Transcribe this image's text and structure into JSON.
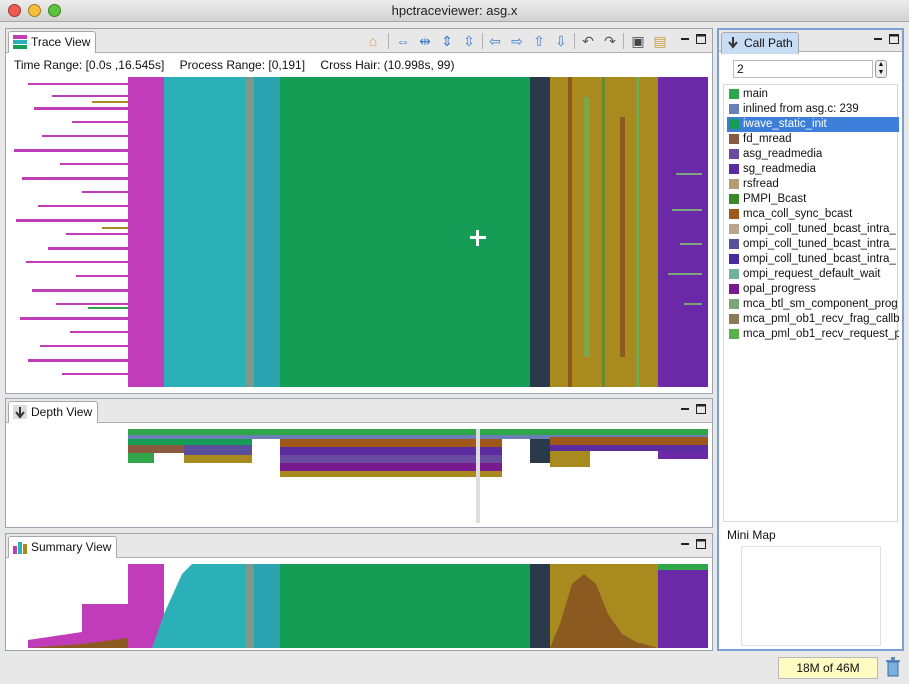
{
  "app": {
    "title": "hpctraceviewer: asg.x"
  },
  "trace_view": {
    "tab_label": "Trace View",
    "time_range": "Time Range: [0.0s ,16.545s]",
    "process_range": "Process Range: [0,191]",
    "cross_hair": "Cross Hair: (10.998s, 99)"
  },
  "depth_view": {
    "tab_label": "Depth View"
  },
  "summary_view": {
    "tab_label": "Summary View"
  },
  "call_path": {
    "tab_label": "Call Path",
    "depth_value": "2",
    "items": [
      {
        "label": "main",
        "color": "#2fa64a"
      },
      {
        "label": "inlined from asg.c: 239",
        "color": "#6a80b4"
      },
      {
        "label": "iwave_static_init",
        "color": "#169d55",
        "selected": true
      },
      {
        "label": "fd_mread",
        "color": "#8a5a40"
      },
      {
        "label": "asg_readmedia",
        "color": "#6a4ba0"
      },
      {
        "label": "sg_readmedia",
        "color": "#5b2ba0"
      },
      {
        "label": "rsfread",
        "color": "#b89a78"
      },
      {
        "label": "PMPI_Bcast",
        "color": "#3b8a2a"
      },
      {
        "label": "mca_coll_sync_bcast",
        "color": "#a0581a"
      },
      {
        "label": "ompi_coll_tuned_bcast_intra_",
        "color": "#b9a58a"
      },
      {
        "label": "ompi_coll_tuned_bcast_intra_",
        "color": "#5a4f9a"
      },
      {
        "label": "ompi_coll_tuned_bcast_intra_",
        "color": "#4a2aa0"
      },
      {
        "label": "ompi_request_default_wait",
        "color": "#6fb39a"
      },
      {
        "label": "opal_progress",
        "color": "#7a1a90"
      },
      {
        "label": "mca_btl_sm_component_prog",
        "color": "#7aa67a"
      },
      {
        "label": "mca_pml_ob1_recv_frag_callb",
        "color": "#8a7a5a"
      },
      {
        "label": "mca_pml_ob1_recv_request_p",
        "color": "#5ab04a"
      }
    ],
    "mini_map_label": "Mini Map"
  },
  "status": {
    "memory": "18M of 46M"
  },
  "colors": {
    "magenta": "#c03cb8",
    "teal": "#2cb0b8",
    "green": "#169d55",
    "navy": "#2b3a4a",
    "olive": "#a88a1e",
    "purple": "#6a2aa8"
  }
}
